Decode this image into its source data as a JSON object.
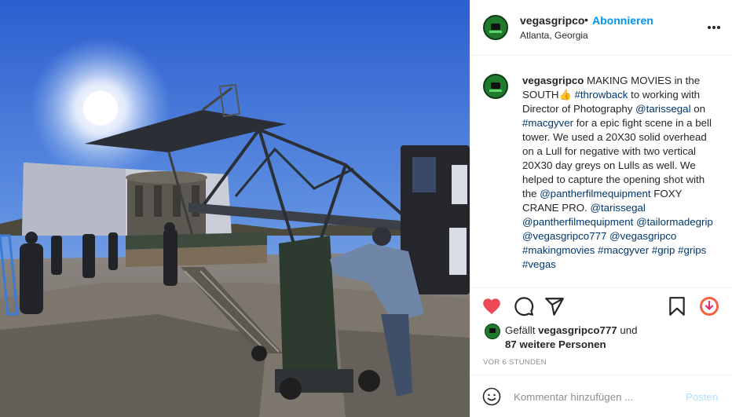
{
  "header": {
    "username": "vegasgripco",
    "separator": "•",
    "follow_label": "Abonnieren",
    "location": "Atlanta, Georgia",
    "more_icon": "more-options-icon"
  },
  "caption": {
    "username": "vegasgripco",
    "part1": " MAKING MOVIES in the SOUTH",
    "emoji": "👍",
    "tag_throwback": "#throwback",
    "part2": " to working with Director of Photography ",
    "mention_tarissegal": "@tarissegal",
    "part3": " on ",
    "tag_macgyver": "#macgyver",
    "part4": " for a epic fight scene in a bell tower. We used a 20X30 solid overhead on a Lull for negative with two vertical 20X30 day greys on Lulls as well. We helped to capture the opening shot with the ",
    "mention_panther1": "@pantherfilmequipment",
    "part5": " FOXY CRANE PRO. ",
    "mention_tarissegal2": "@tarissegal",
    "mention_panther2": "@pantherfilmequipment",
    "mention_tailormadegrip": "@tailormadegrip",
    "mention_vegasgripco777": "@vegasgripco777",
    "mention_vegasgripco": "@vegasgripco",
    "tag_makingmovies": "#makingmovies",
    "tag_macgyver2": "#macgyver",
    "tag_grip": "#grip",
    "tag_grips": "#grips",
    "tag_vegas": "#vegas"
  },
  "actions": {
    "like_icon": "heart-filled-icon",
    "comment_icon": "comment-icon",
    "share_icon": "share-icon",
    "save_icon": "bookmark-icon",
    "extension_icon": "download-extension-icon",
    "like_color": "#ed4956"
  },
  "likes": {
    "prefix": "Gefällt ",
    "liked_by": "vegasgripco777",
    "suffix": " und",
    "others": "87 weitere Personen"
  },
  "timestamp": "VOR 6 STUNDEN",
  "comment": {
    "placeholder": "Kommentar hinzufügen ...",
    "post_label": "Posten",
    "emoji_icon": "smiley-icon"
  }
}
